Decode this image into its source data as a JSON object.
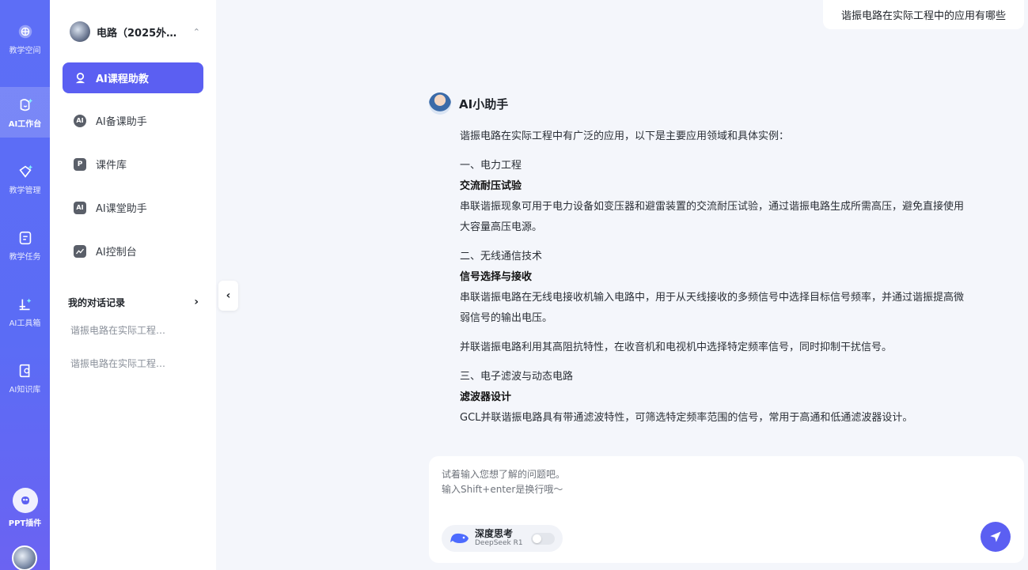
{
  "rail": {
    "items": [
      {
        "label": "教学空间",
        "icon": "globe-icon"
      },
      {
        "label": "AI工作台",
        "icon": "ai-workbench-icon"
      },
      {
        "label": "教学管理",
        "icon": "teaching-manage-icon"
      },
      {
        "label": "教学任务",
        "icon": "task-icon"
      },
      {
        "label": "AI工具箱",
        "icon": "toolbox-icon"
      },
      {
        "label": "AI知识库",
        "icon": "knowledge-icon"
      }
    ],
    "ppt_label": "PPT插件"
  },
  "sidebar": {
    "course": "电路（2025外…",
    "nav": [
      {
        "label": "AI课程助教",
        "active": true
      },
      {
        "label": "AI备课助手"
      },
      {
        "label": "课件库"
      },
      {
        "label": "AI课堂助手"
      },
      {
        "label": "AI控制台"
      }
    ],
    "history_title": "我的对话记录",
    "history": [
      "谐振电路在实际工程…",
      "谐振电路在实际工程…"
    ]
  },
  "chat": {
    "user_question": "谐振电路在实际工程中的应用有哪些",
    "bot_name": "AI小助手",
    "answer": {
      "intro": "谐振电路在实际工程中有广泛的应用，以下是主要应用领域和具体实例：",
      "s1_title": "一、电力工程",
      "s1_h": "交流耐压试验",
      "s1_p1": "串联谐振现象可用于电力设备如变压器和避雷装置的交流耐压试验，通过谐振电路生成所需高压，避免直接使用",
      "s1_p2": "大容量高压电源。",
      "s2_title": "二、无线通信技术",
      "s2_h": "信号选择与接收",
      "s2_p1": "串联谐振电路在无线电接收机输入电路中，用于从天线接收的多频信号中选择目标信号频率，并通过谐振提高微",
      "s2_p2": "弱信号的输出电压。",
      "s2_p3": "并联谐振电路利用其高阻抗特性，在收音机和电视机中选择特定频率信号，同时抑制干扰信号。",
      "s3_title": "三、电子滤波与动态电路",
      "s3_h": "滤波器设计",
      "s3_p1": "GCL并联谐振电路具有带通滤波特性，可筛选特定频率范围的信号，常用于高通和低通滤波器设计。"
    }
  },
  "input": {
    "placeholder_line1": "试着输入您想了解的问题吧。",
    "placeholder_line2": "输入Shift+enter是换行哦～",
    "deep_title": "深度思考",
    "deep_sub": "DeepSeek R1",
    "deep_enabled": false
  },
  "colors": {
    "accent": "#5b5ff2",
    "rail": "#5d6ef6"
  }
}
